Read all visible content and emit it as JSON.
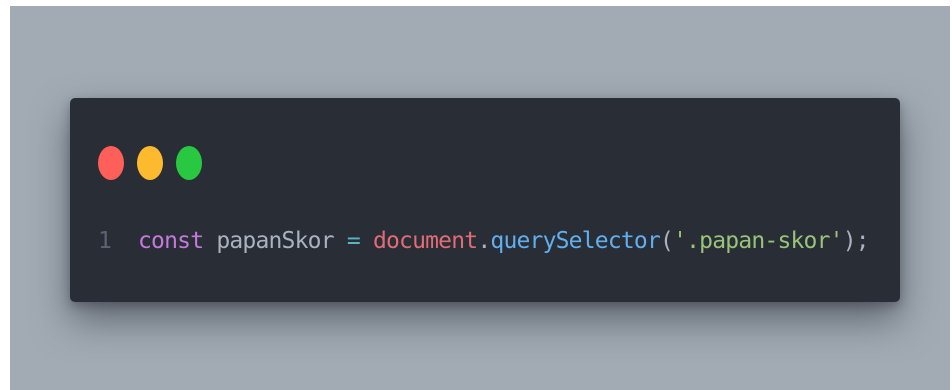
{
  "editor": {
    "window_controls": [
      {
        "name": "close",
        "color": "#fe5f58"
      },
      {
        "name": "minimize",
        "color": "#fdba2e"
      },
      {
        "name": "maximize",
        "color": "#28c940"
      }
    ],
    "lines": [
      {
        "number": "1",
        "tokens": {
          "keyword": "const",
          "space1": " ",
          "identifier": "papanSkor",
          "space2": " ",
          "operator": "=",
          "space3": " ",
          "object": "document",
          "dot": ".",
          "method": "querySelector",
          "open_paren": "(",
          "string": "'.papan-skor'",
          "close_paren_semicolon": ");"
        }
      }
    ]
  }
}
